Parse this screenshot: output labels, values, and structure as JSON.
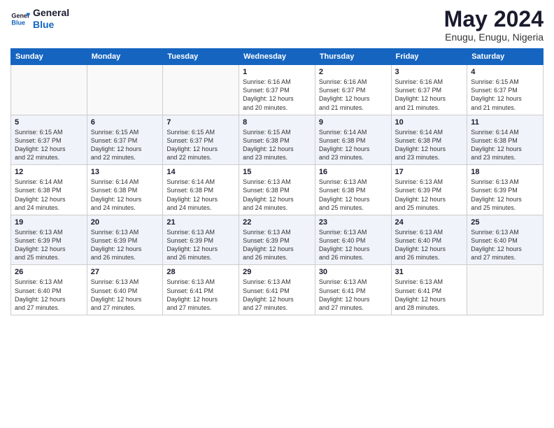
{
  "logo": {
    "line1": "General",
    "line2": "Blue"
  },
  "title": "May 2024",
  "subtitle": "Enugu, Enugu, Nigeria",
  "weekdays": [
    "Sunday",
    "Monday",
    "Tuesday",
    "Wednesday",
    "Thursday",
    "Friday",
    "Saturday"
  ],
  "weeks": [
    [
      {
        "day": "",
        "info": ""
      },
      {
        "day": "",
        "info": ""
      },
      {
        "day": "",
        "info": ""
      },
      {
        "day": "1",
        "info": "Sunrise: 6:16 AM\nSunset: 6:37 PM\nDaylight: 12 hours\nand 20 minutes."
      },
      {
        "day": "2",
        "info": "Sunrise: 6:16 AM\nSunset: 6:37 PM\nDaylight: 12 hours\nand 21 minutes."
      },
      {
        "day": "3",
        "info": "Sunrise: 6:16 AM\nSunset: 6:37 PM\nDaylight: 12 hours\nand 21 minutes."
      },
      {
        "day": "4",
        "info": "Sunrise: 6:15 AM\nSunset: 6:37 PM\nDaylight: 12 hours\nand 21 minutes."
      }
    ],
    [
      {
        "day": "5",
        "info": "Sunrise: 6:15 AM\nSunset: 6:37 PM\nDaylight: 12 hours\nand 22 minutes."
      },
      {
        "day": "6",
        "info": "Sunrise: 6:15 AM\nSunset: 6:37 PM\nDaylight: 12 hours\nand 22 minutes."
      },
      {
        "day": "7",
        "info": "Sunrise: 6:15 AM\nSunset: 6:37 PM\nDaylight: 12 hours\nand 22 minutes."
      },
      {
        "day": "8",
        "info": "Sunrise: 6:15 AM\nSunset: 6:38 PM\nDaylight: 12 hours\nand 23 minutes."
      },
      {
        "day": "9",
        "info": "Sunrise: 6:14 AM\nSunset: 6:38 PM\nDaylight: 12 hours\nand 23 minutes."
      },
      {
        "day": "10",
        "info": "Sunrise: 6:14 AM\nSunset: 6:38 PM\nDaylight: 12 hours\nand 23 minutes."
      },
      {
        "day": "11",
        "info": "Sunrise: 6:14 AM\nSunset: 6:38 PM\nDaylight: 12 hours\nand 23 minutes."
      }
    ],
    [
      {
        "day": "12",
        "info": "Sunrise: 6:14 AM\nSunset: 6:38 PM\nDaylight: 12 hours\nand 24 minutes."
      },
      {
        "day": "13",
        "info": "Sunrise: 6:14 AM\nSunset: 6:38 PM\nDaylight: 12 hours\nand 24 minutes."
      },
      {
        "day": "14",
        "info": "Sunrise: 6:14 AM\nSunset: 6:38 PM\nDaylight: 12 hours\nand 24 minutes."
      },
      {
        "day": "15",
        "info": "Sunrise: 6:13 AM\nSunset: 6:38 PM\nDaylight: 12 hours\nand 24 minutes."
      },
      {
        "day": "16",
        "info": "Sunrise: 6:13 AM\nSunset: 6:38 PM\nDaylight: 12 hours\nand 25 minutes."
      },
      {
        "day": "17",
        "info": "Sunrise: 6:13 AM\nSunset: 6:39 PM\nDaylight: 12 hours\nand 25 minutes."
      },
      {
        "day": "18",
        "info": "Sunrise: 6:13 AM\nSunset: 6:39 PM\nDaylight: 12 hours\nand 25 minutes."
      }
    ],
    [
      {
        "day": "19",
        "info": "Sunrise: 6:13 AM\nSunset: 6:39 PM\nDaylight: 12 hours\nand 25 minutes."
      },
      {
        "day": "20",
        "info": "Sunrise: 6:13 AM\nSunset: 6:39 PM\nDaylight: 12 hours\nand 26 minutes."
      },
      {
        "day": "21",
        "info": "Sunrise: 6:13 AM\nSunset: 6:39 PM\nDaylight: 12 hours\nand 26 minutes."
      },
      {
        "day": "22",
        "info": "Sunrise: 6:13 AM\nSunset: 6:39 PM\nDaylight: 12 hours\nand 26 minutes."
      },
      {
        "day": "23",
        "info": "Sunrise: 6:13 AM\nSunset: 6:40 PM\nDaylight: 12 hours\nand 26 minutes."
      },
      {
        "day": "24",
        "info": "Sunrise: 6:13 AM\nSunset: 6:40 PM\nDaylight: 12 hours\nand 26 minutes."
      },
      {
        "day": "25",
        "info": "Sunrise: 6:13 AM\nSunset: 6:40 PM\nDaylight: 12 hours\nand 27 minutes."
      }
    ],
    [
      {
        "day": "26",
        "info": "Sunrise: 6:13 AM\nSunset: 6:40 PM\nDaylight: 12 hours\nand 27 minutes."
      },
      {
        "day": "27",
        "info": "Sunrise: 6:13 AM\nSunset: 6:40 PM\nDaylight: 12 hours\nand 27 minutes."
      },
      {
        "day": "28",
        "info": "Sunrise: 6:13 AM\nSunset: 6:41 PM\nDaylight: 12 hours\nand 27 minutes."
      },
      {
        "day": "29",
        "info": "Sunrise: 6:13 AM\nSunset: 6:41 PM\nDaylight: 12 hours\nand 27 minutes."
      },
      {
        "day": "30",
        "info": "Sunrise: 6:13 AM\nSunset: 6:41 PM\nDaylight: 12 hours\nand 27 minutes."
      },
      {
        "day": "31",
        "info": "Sunrise: 6:13 AM\nSunset: 6:41 PM\nDaylight: 12 hours\nand 28 minutes."
      },
      {
        "day": "",
        "info": ""
      }
    ]
  ]
}
